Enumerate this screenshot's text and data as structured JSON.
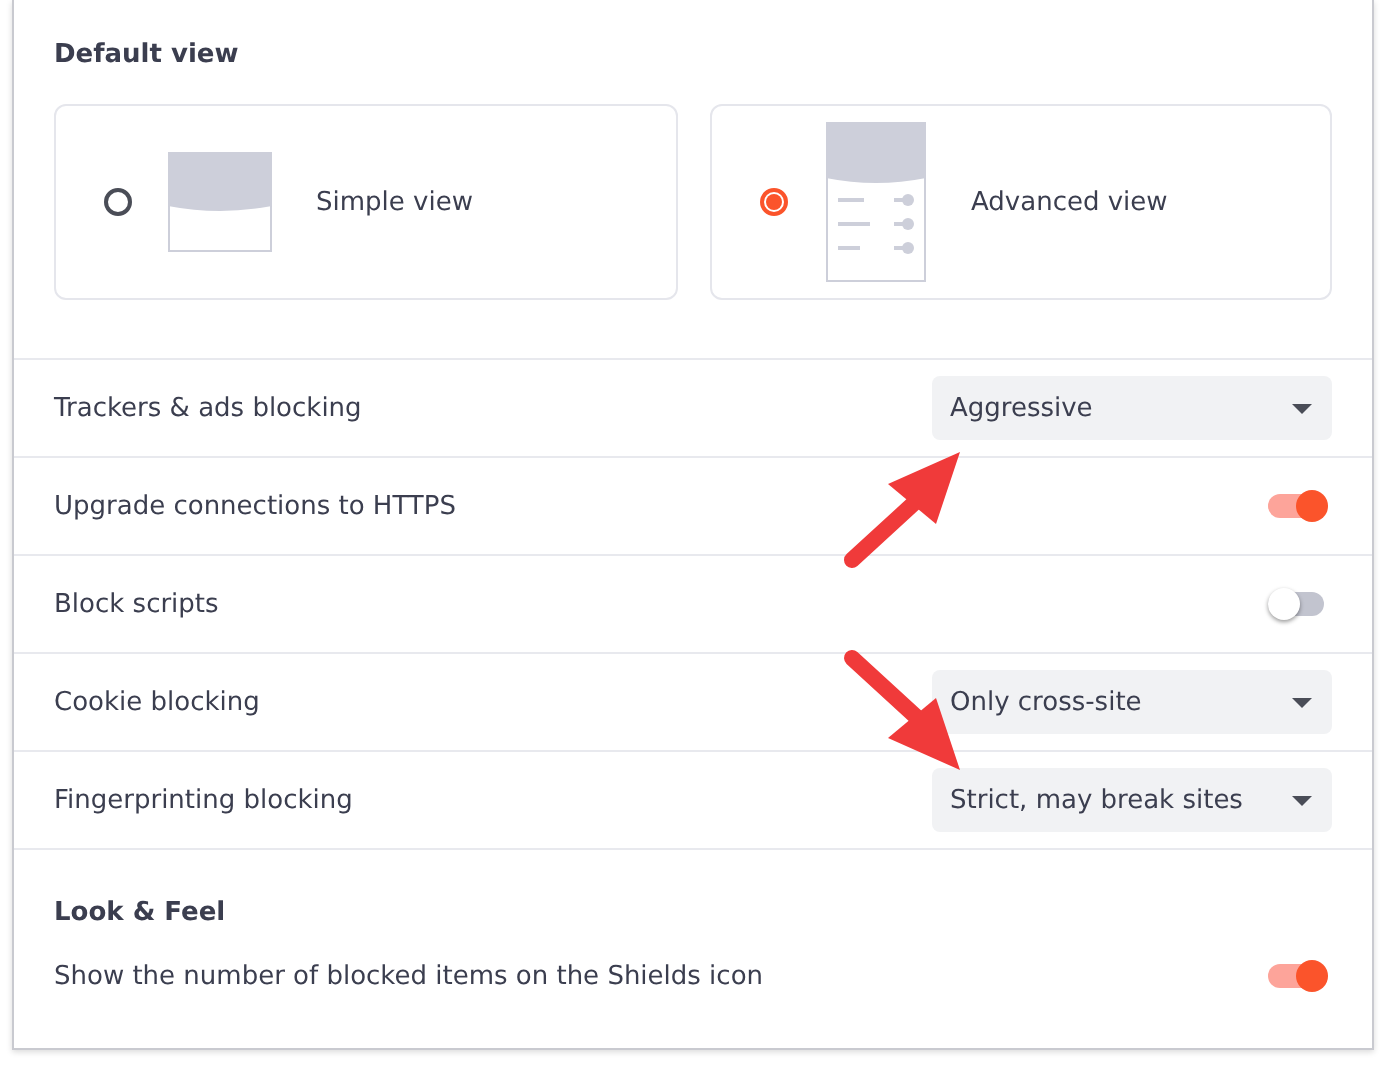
{
  "default_view": {
    "heading": "Default view",
    "options": [
      {
        "kind": "simple",
        "label": "Simple view",
        "selected": false
      },
      {
        "kind": "advanced",
        "label": "Advanced view",
        "selected": true
      }
    ]
  },
  "settings": [
    {
      "kind": "select",
      "label": "Trackers & ads blocking",
      "value": "Aggressive"
    },
    {
      "kind": "toggle",
      "label": "Upgrade connections to HTTPS",
      "on": true
    },
    {
      "kind": "toggle",
      "label": "Block scripts",
      "on": false
    },
    {
      "kind": "select",
      "label": "Cookie blocking",
      "value": "Only cross-site"
    },
    {
      "kind": "select",
      "label": "Fingerprinting blocking",
      "value": "Strict, may break sites"
    }
  ],
  "annotations": [
    {
      "kind": "arrow_up_right"
    },
    {
      "kind": "arrow_down_right"
    }
  ],
  "look_and_feel": {
    "heading": "Look & Feel",
    "settings": [
      {
        "kind": "toggle",
        "label": "Show the number of blocked items on the Shields icon",
        "on": true
      }
    ]
  }
}
